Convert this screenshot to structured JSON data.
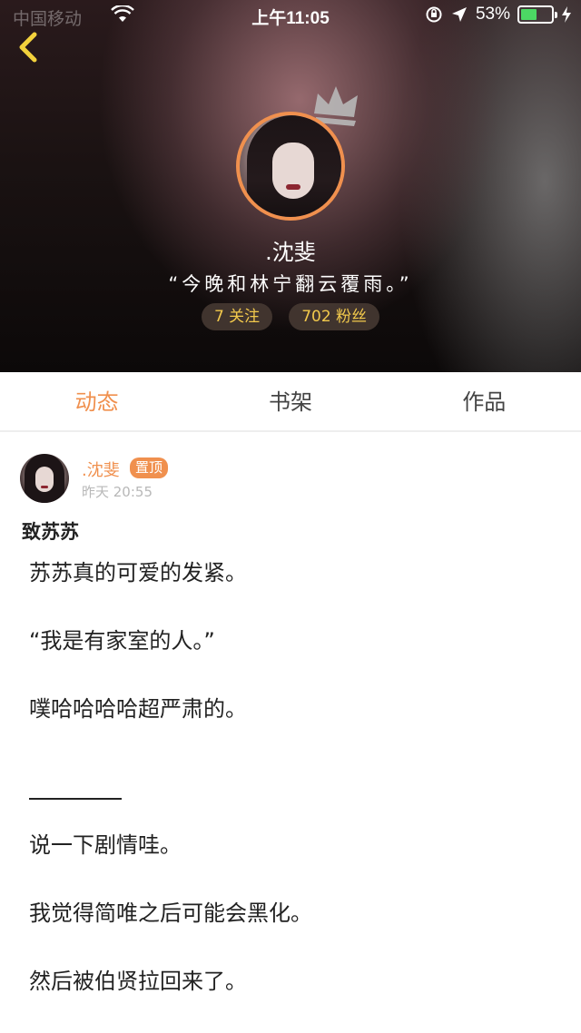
{
  "status_bar": {
    "carrier": "中国移动",
    "time": "上午11:05",
    "battery_percent": "53%",
    "battery_level": 0.53,
    "icons": [
      "wifi-icon",
      "rotation-lock-icon",
      "location-icon",
      "battery-icon",
      "charging-icon"
    ]
  },
  "profile": {
    "name": ".沈斐",
    "signature": "“今晚和林宁翻云覆雨。”",
    "following": "7 关注",
    "followers": "702 粉丝",
    "accent_color": "#f0904e",
    "stat_color": "#f2c94c"
  },
  "tabs": [
    {
      "label": "动态",
      "active": true
    },
    {
      "label": "书架",
      "active": false
    },
    {
      "label": "作品",
      "active": false
    }
  ],
  "post": {
    "author": ".沈斐",
    "badge": "置顶",
    "time": "昨天 20:55",
    "title": "致苏苏",
    "paragraphs": [
      "苏苏真的可爱的发紧。",
      "“我是有家室的人。”",
      "噗哈哈哈哈超严肃的。",
      "",
      "说一下剧情哇。",
      "我觉得简唯之后可能会黑化。",
      "然后被伯贤拉回来了。"
    ]
  }
}
